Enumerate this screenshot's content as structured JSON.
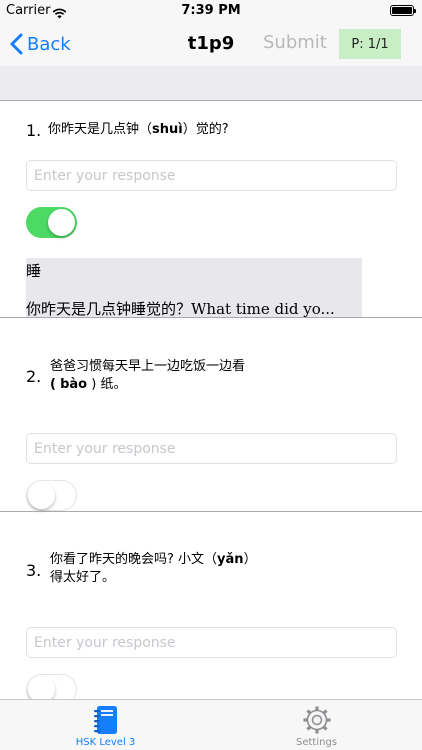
{
  "status_bar": {
    "carrier": "Carrier",
    "time": "7:39 PM"
  },
  "nav": {
    "back_label": "Back",
    "title": "t1p9",
    "submit_label": "Submit",
    "page_badge": "P: 1/1"
  },
  "questions": [
    {
      "number": "1.",
      "text_before": "你昨天是几点钟（",
      "pinyin": "shuì",
      "text_after": "）觉的?",
      "placeholder": "Enter your response",
      "toggle_on": true,
      "answer_char": "睡",
      "answer_sentence": "你昨天是几点钟睡觉的？What time did yo..."
    },
    {
      "number": "2.",
      "line1": "爸爸习惯每天早上一边吃饭一边看",
      "line2_before": "(",
      "pinyin": "bào",
      "line2_after": ") 纸。",
      "placeholder": "Enter your response",
      "toggle_on": false
    },
    {
      "number": "3.",
      "line1_before": "你看了昨天的晚会吗? 小文（",
      "pinyin": "yǎn",
      "line1_after": "）",
      "line2": "得太好了。",
      "placeholder": "Enter your response",
      "toggle_on": false
    }
  ],
  "tabs": [
    {
      "label": "HSK Level 3",
      "icon": "notebook-icon",
      "active": true
    },
    {
      "label": "Settings",
      "icon": "gear-icon",
      "active": false
    }
  ],
  "colors": {
    "accent": "#147efb",
    "toggle_on": "#4cd964",
    "badge_bg": "#c8eec5"
  }
}
